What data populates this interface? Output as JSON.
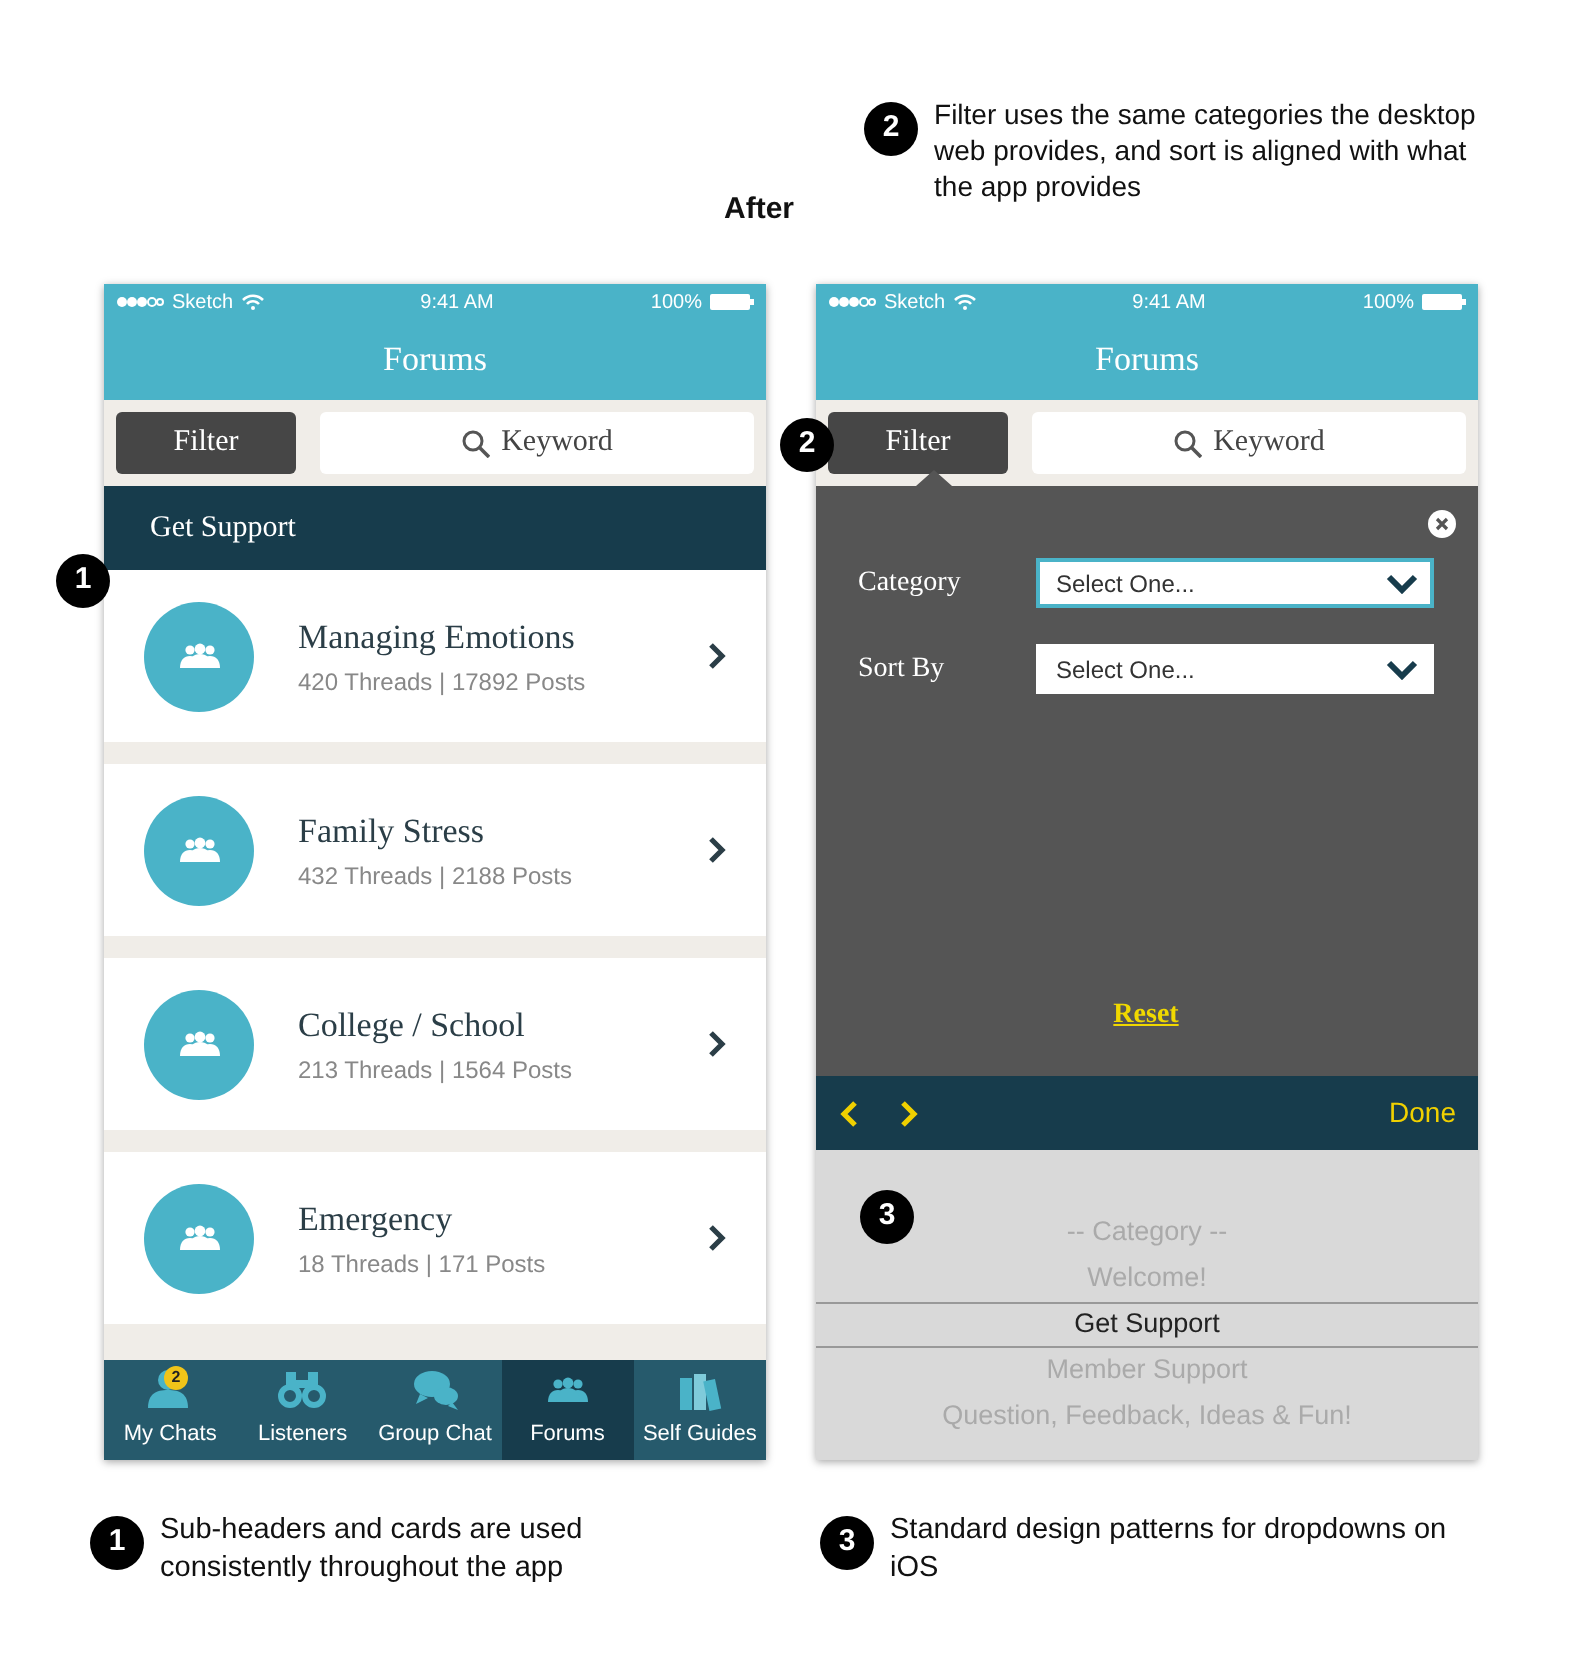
{
  "top_note": {
    "number": "2",
    "text": "Filter uses the same categories the desktop web provides, and sort is aligned with what the app provides"
  },
  "heading": "After",
  "screens": [
    {
      "kind": "list",
      "status": {
        "carrier": "Sketch",
        "time": "9:41 AM",
        "battery": "100%"
      },
      "title": "Forums",
      "filter_button": "Filter",
      "search": {
        "placeholder": "Keyword"
      },
      "section_header": "Get Support",
      "callout": "1",
      "forums": [
        {
          "title": "Managing Emotions",
          "stats": "420 Threads | 17892 Posts"
        },
        {
          "title": "Family Stress",
          "stats": "432 Threads | 2188 Posts"
        },
        {
          "title": "College / School",
          "stats": "213 Threads | 1564 Posts"
        },
        {
          "title": "Emergency",
          "stats": "18 Threads | 171 Posts"
        }
      ],
      "tabs": [
        {
          "label": "My Chats",
          "kind": "person",
          "badge": "2",
          "selected": false
        },
        {
          "label": "Listeners",
          "kind": "binoculars",
          "selected": false
        },
        {
          "label": "Group Chat",
          "kind": "bubbles",
          "selected": false
        },
        {
          "label": "Forums",
          "kind": "group",
          "selected": true
        },
        {
          "label": "Self Guides",
          "kind": "books",
          "selected": false
        }
      ]
    },
    {
      "kind": "filter",
      "status": {
        "carrier": "Sketch",
        "time": "9:41 AM",
        "battery": "100%"
      },
      "title": "Forums",
      "filter_button": "Filter",
      "search": {
        "placeholder": "Keyword"
      },
      "callout": "2",
      "fields": [
        {
          "label": "Category",
          "value": "Select One...",
          "focused": true
        },
        {
          "label": "Sort By",
          "value": "Select One...",
          "focused": false
        }
      ],
      "reset": "Reset",
      "done": "Done",
      "picker_callout": "3",
      "options": [
        {
          "label": "-- Category --",
          "selected": false
        },
        {
          "label": "Welcome!",
          "selected": false
        },
        {
          "label": "Get Support",
          "selected": true
        },
        {
          "label": "Member Support",
          "selected": false
        },
        {
          "label": "Question, Feedback, Ideas & Fun!",
          "selected": false
        }
      ]
    }
  ],
  "bottom_notes": [
    {
      "number": "1",
      "text": "Sub-headers and cards are used consistently throughout the app"
    },
    {
      "number": "3",
      "text": "Standard design patterns for dropdowns on iOS"
    }
  ]
}
